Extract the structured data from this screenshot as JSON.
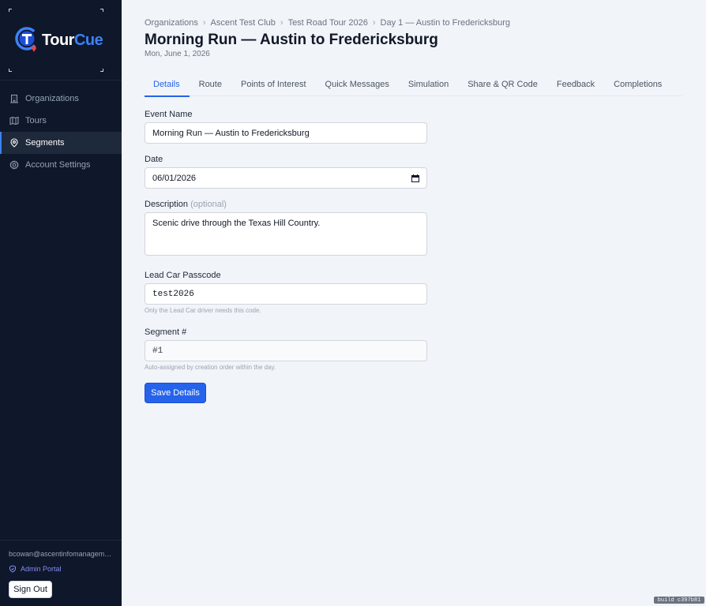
{
  "brand": {
    "name_part1": "Tour",
    "name_part2": "Cue",
    "accent": "#3b82f6"
  },
  "sidebar": {
    "items": [
      {
        "label": "Organizations",
        "icon": "building-icon",
        "active": false
      },
      {
        "label": "Tours",
        "icon": "map-icon",
        "active": false
      },
      {
        "label": "Segments",
        "icon": "map-pin-icon",
        "active": true
      },
      {
        "label": "Account Settings",
        "icon": "gear-icon",
        "active": false
      }
    ],
    "user_email": "bcowan@ascentinfomanagemen…",
    "admin_link": "Admin Portal",
    "signout_label": "Sign Out"
  },
  "breadcrumb": [
    "Organizations",
    "Ascent Test Club",
    "Test Road Tour 2026",
    "Day 1 — Austin to Fredericksburg"
  ],
  "header": {
    "title": "Morning Run — Austin to Fredericksburg",
    "subtitle": "Mon, June 1, 2026"
  },
  "tabs": [
    "Details",
    "Route",
    "Points of Interest",
    "Quick Messages",
    "Simulation",
    "Share & QR Code",
    "Feedback",
    "Completions"
  ],
  "active_tab": "Details",
  "form": {
    "event_name_label": "Event Name",
    "event_name_value": "Morning Run — Austin to Fredericksburg",
    "date_label": "Date",
    "date_value": "06/01/2026",
    "description_label": "Description",
    "description_optional": "(optional)",
    "description_value": "Scenic drive through the Texas Hill Country.",
    "passcode_label": "Lead Car Passcode",
    "passcode_value": "test2026",
    "passcode_help": "Only the Lead Car driver needs this code.",
    "segment_label": "Segment #",
    "segment_value": "#1",
    "segment_help": "Auto-assigned by creation order within the day.",
    "save_label": "Save Details"
  },
  "build": "build c397b81"
}
